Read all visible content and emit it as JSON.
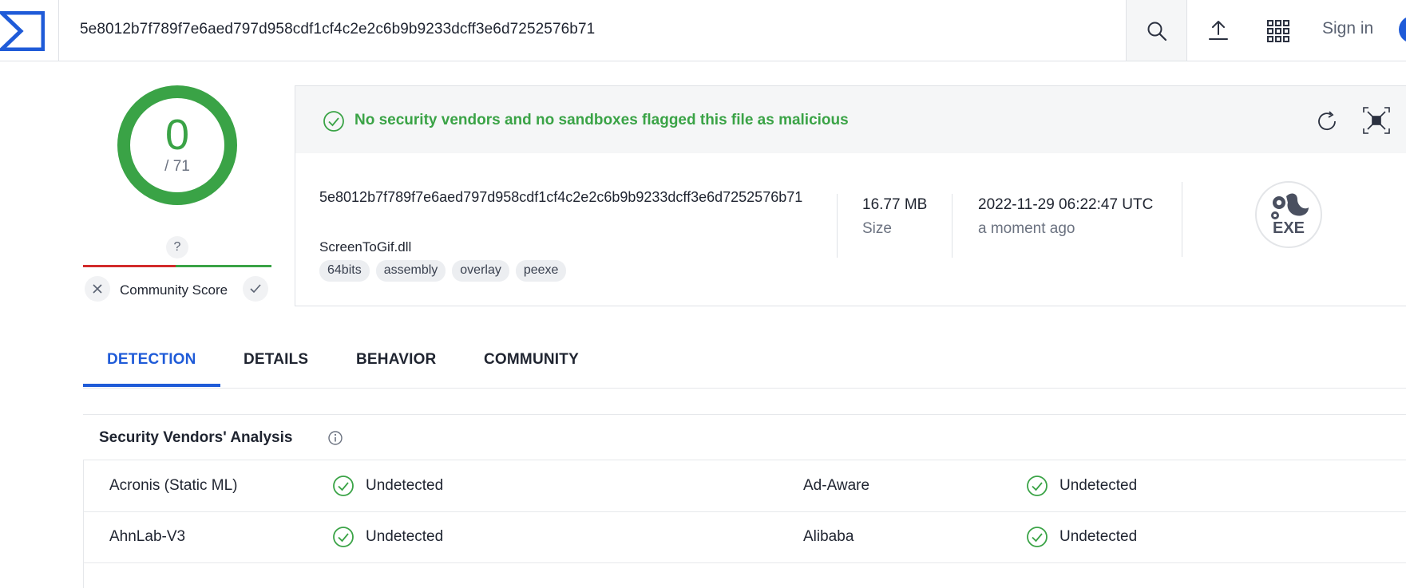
{
  "header": {
    "search_value": "5e8012b7f789f7e6aed797d958cdf1cf4c2e2c6b9b9233dcff3e6d7252576b71",
    "signin_label": "Sign in"
  },
  "score": {
    "detections": "0",
    "total": "/ 71",
    "community_unknown": "?",
    "community_label": "Community Score"
  },
  "file": {
    "banner": "No security vendors and no sandboxes flagged this file as malicious",
    "hash": "5e8012b7f789f7e6aed797d958cdf1cf4c2e2c6b9b9233dcff3e6d7252576b71",
    "name": "ScreenToGif.dll",
    "tags": [
      "64bits",
      "assembly",
      "overlay",
      "peexe"
    ],
    "size_value": "16.77 MB",
    "size_label": "Size",
    "date_value": "2022-11-29 06:22:47 UTC",
    "date_relative": "a moment ago",
    "type_icon": "EXE"
  },
  "tabs": [
    {
      "label": "DETECTION",
      "active": true
    },
    {
      "label": "DETAILS",
      "active": false
    },
    {
      "label": "BEHAVIOR",
      "active": false
    },
    {
      "label": "COMMUNITY",
      "active": false
    }
  ],
  "vendors": {
    "title": "Security Vendors' Analysis",
    "rows": [
      [
        {
          "vendor": "Acronis (Static ML)",
          "result": "Undetected"
        },
        {
          "vendor": "Ad-Aware",
          "result": "Undetected"
        }
      ],
      [
        {
          "vendor": "AhnLab-V3",
          "result": "Undetected"
        },
        {
          "vendor": "Alibaba",
          "result": "Undetected"
        }
      ]
    ]
  },
  "colors": {
    "accent": "#1f5bd8",
    "clean": "#3aa346",
    "malicious": "#d22b2b"
  }
}
